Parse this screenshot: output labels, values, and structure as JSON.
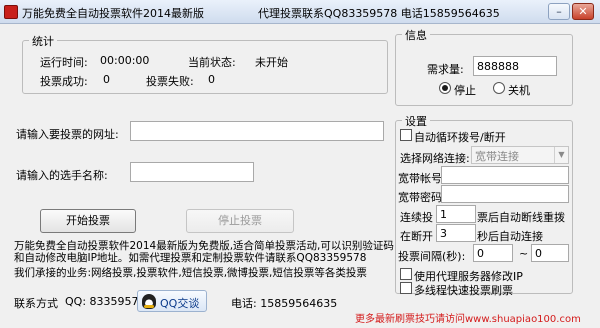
{
  "window": {
    "title": "万能免费全自动投票软件2014最新版",
    "agent_info": "代理投票联系QQ83359578 电话15859564635",
    "minimize_glyph": "–",
    "close_glyph": "✕"
  },
  "stats": {
    "group_title": "统计",
    "run_time_label": "运行时间:",
    "run_time_value": "00:00:00",
    "status_label": "当前状态:",
    "status_value": "未开始",
    "vote_success_label": "投票成功:",
    "vote_success_value": "0",
    "vote_fail_label": "投票失败:",
    "vote_fail_value": "0"
  },
  "form": {
    "url_label": "请输入要投票的网址:",
    "url_value": "",
    "player_label": "请输入的选手名称:",
    "player_value": "",
    "start_button": "开始投票",
    "stop_button": "停止投票"
  },
  "info_panel": {
    "group_title": "信息",
    "password_label": "需求量:",
    "password_value": "888888",
    "radio_stop": "停止",
    "radio_shutdown": "关机",
    "radio_selected": "stop"
  },
  "settings": {
    "group_title": "设置",
    "auto_dial_label": "自动循环拨号/断开",
    "auto_dial_checked": false,
    "connection_label": "选择网络连接:",
    "connection_value": "宽带连接",
    "broadband_account_label": "宽带帐号:",
    "broadband_account_value": "",
    "broadband_password_label": "宽带密码:",
    "broadband_password_value": "",
    "continuous_vote_label": "连续投",
    "continuous_vote_value": "1",
    "continuous_vote_suffix": "票后自动断线重拨",
    "disconnect_label": "在断开",
    "disconnect_value": "3",
    "disconnect_suffix": "秒后自动连接",
    "interval_label": "投票间隔(秒):",
    "interval_from": "0",
    "interval_separator": "~",
    "interval_to": "0",
    "proxy_label": "使用代理服务器修改IP",
    "proxy_checked": false,
    "multithread_label": "多线程快速投票刷票",
    "multithread_checked": false
  },
  "description": {
    "intro": "万能免费全自动投票软件2014最新版为免费版,适合简单投票活动,可以识别验证码和自动修改电脑IP地址。如需代理投票和定制投票软件请联系QQ83359578",
    "services": "我们承接的业务:网络投票,投票软件,短信投票,微博投票,短信投票等各类投票"
  },
  "contact": {
    "label": "联系方式",
    "qq": "QQ: 83359578",
    "qq_button": "QQ交谈",
    "phone": "电话: 15859564635"
  },
  "promo": {
    "link_text": "更多最新刷票技巧请访问www.shuapiao100.com"
  },
  "colors": {
    "promo_red": "#d41b1b",
    "window_bg": "#f0f0f0"
  }
}
